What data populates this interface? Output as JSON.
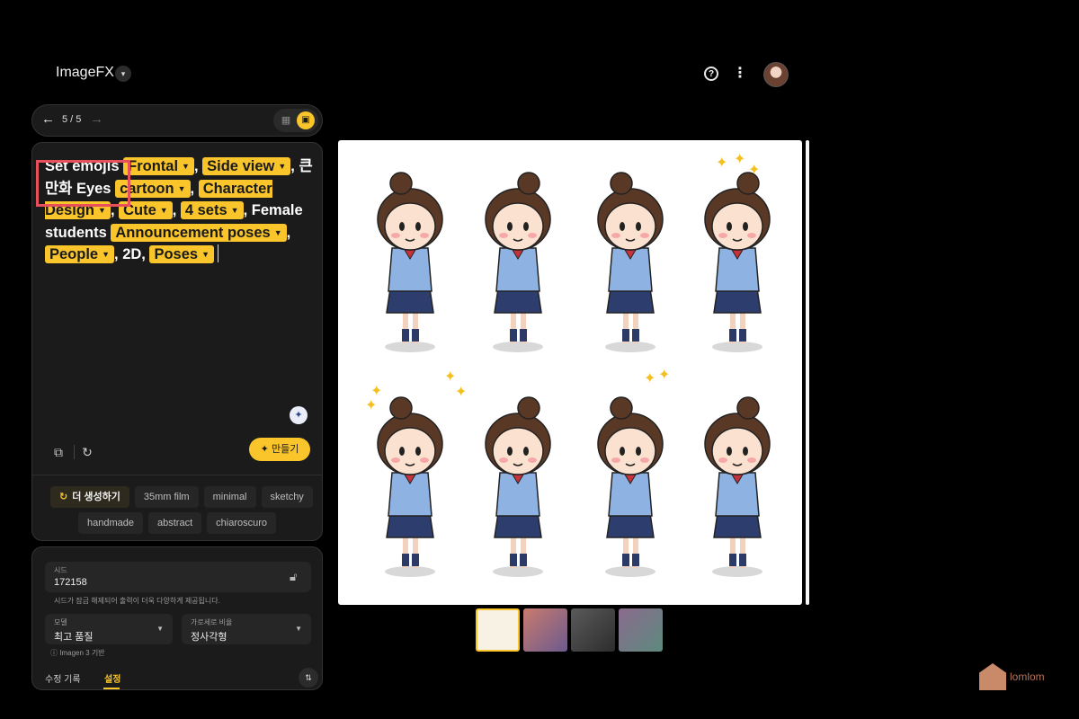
{
  "header": {
    "app_title": "ImageFX"
  },
  "nav": {
    "counter": "5 / 5"
  },
  "prompt": {
    "segments": [
      {
        "type": "text",
        "text": "Set emojis "
      },
      {
        "type": "chip",
        "text": "Frontal"
      },
      {
        "type": "text",
        "text": ", "
      },
      {
        "type": "chip",
        "text": "Side view"
      },
      {
        "type": "text",
        "text": ", "
      },
      {
        "type": "text",
        "text": "큰 만화 Eyes "
      },
      {
        "type": "chip",
        "text": "cartoon"
      },
      {
        "type": "text",
        "text": ", "
      },
      {
        "type": "chip",
        "text": "Character Design"
      },
      {
        "type": "text",
        "text": ", "
      },
      {
        "type": "chip",
        "text": "Cute"
      },
      {
        "type": "text",
        "text": ", "
      },
      {
        "type": "chip",
        "text": "4 sets"
      },
      {
        "type": "text",
        "text": ", Female students "
      },
      {
        "type": "chip",
        "text": "Announcement poses"
      },
      {
        "type": "text",
        "text": ", "
      },
      {
        "type": "chip",
        "text": "People"
      },
      {
        "type": "text",
        "text": ", 2D, "
      },
      {
        "type": "chip",
        "text": "Poses"
      }
    ],
    "generate_label": "만들기"
  },
  "style_chips": {
    "regenerate_label": "더 생성하기",
    "row1": [
      "35mm film",
      "minimal",
      "sketchy"
    ],
    "row2": [
      "handmade",
      "abstract",
      "chiaroscuro"
    ]
  },
  "settings": {
    "seed_label": "시드",
    "seed_value": "172158",
    "seed_description": "시드가 잠금 해제되어 출력이 더욱 다양하게 제공됩니다.",
    "model_label": "모델",
    "model_value": "최고 품질",
    "ratio_label": "가로세로 비율",
    "ratio_value": "정사각형",
    "model_note": "Imagen 3 기반",
    "tab_history": "수정 기록",
    "tab_settings": "설정"
  },
  "colors": {
    "accent": "#f9c52b",
    "background": "#000000",
    "panel": "#1b1b1b",
    "highlight_box": "#e8505b"
  },
  "icons": [
    "chevron-down-icon",
    "help-icon",
    "more-vert-icon",
    "arrow-back-icon",
    "arrow-forward-icon",
    "grid-view-icon",
    "single-view-icon",
    "assist-icon",
    "copy-icon",
    "reset-icon",
    "sparkle-icon",
    "refresh-icon",
    "lock-icon",
    "collapse-icon"
  ],
  "watermark": {
    "text": "lomlom"
  }
}
